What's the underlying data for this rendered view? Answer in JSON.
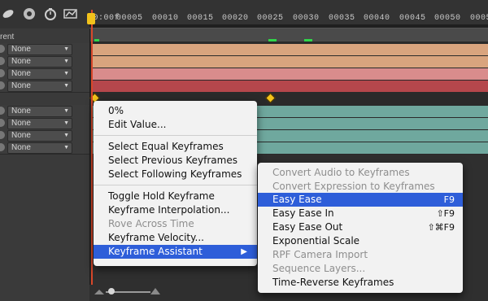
{
  "timeline": {
    "ruler_labels": [
      "00:00f",
      "00005",
      "00010",
      "00015",
      "00020",
      "00025",
      "00030",
      "00035",
      "00040",
      "00045",
      "00050",
      "0005"
    ],
    "panel_header": "rent"
  },
  "layers": [
    {
      "parent": "None"
    },
    {
      "parent": "None"
    },
    {
      "parent": "None"
    },
    {
      "parent": "None"
    },
    {
      "parent": "None"
    },
    {
      "parent": "None"
    },
    {
      "parent": "None"
    },
    {
      "parent": "None"
    }
  ],
  "context_menu": {
    "items": [
      {
        "label": "0%",
        "enabled": true
      },
      {
        "label": "Edit Value...",
        "enabled": true
      },
      {
        "label": "Select Equal Keyframes",
        "enabled": true
      },
      {
        "label": "Select Previous Keyframes",
        "enabled": true
      },
      {
        "label": "Select Following Keyframes",
        "enabled": true
      },
      {
        "label": "Toggle Hold Keyframe",
        "enabled": true
      },
      {
        "label": "Keyframe Interpolation...",
        "enabled": true
      },
      {
        "label": "Rove Across Time",
        "enabled": false
      },
      {
        "label": "Keyframe Velocity...",
        "enabled": true
      },
      {
        "label": "Keyframe Assistant",
        "enabled": true,
        "submenu_arrow": "▶"
      }
    ]
  },
  "submenu": {
    "items": [
      {
        "label": "Convert Audio to Keyframes",
        "enabled": false,
        "shortcut": ""
      },
      {
        "label": "Convert Expression to Keyframes",
        "enabled": false,
        "shortcut": ""
      },
      {
        "label": "Easy Ease",
        "enabled": true,
        "shortcut": "F9"
      },
      {
        "label": "Easy Ease In",
        "enabled": true,
        "shortcut": "⇧F9"
      },
      {
        "label": "Easy Ease Out",
        "enabled": true,
        "shortcut": "⇧⌘F9"
      },
      {
        "label": "Exponential Scale",
        "enabled": true,
        "shortcut": ""
      },
      {
        "label": "RPF Camera Import",
        "enabled": false,
        "shortcut": ""
      },
      {
        "label": "Sequence Layers...",
        "enabled": false,
        "shortcut": ""
      },
      {
        "label": "Time-Reverse Keyframes",
        "enabled": true,
        "shortcut": ""
      }
    ]
  },
  "colors": {
    "highlight": "#2e5ed9",
    "bar_orange": "#d9a47e",
    "bar_pink": "#d98c8c",
    "bar_red": "#b5474c",
    "bar_teal": "#6fa89e",
    "keyframe": "#f2c21b",
    "playhead": "#d8472a"
  },
  "icons": [
    "motion-blur-icon",
    "draft-3d-icon",
    "stopwatch-icon",
    "graph-editor-icon"
  ]
}
